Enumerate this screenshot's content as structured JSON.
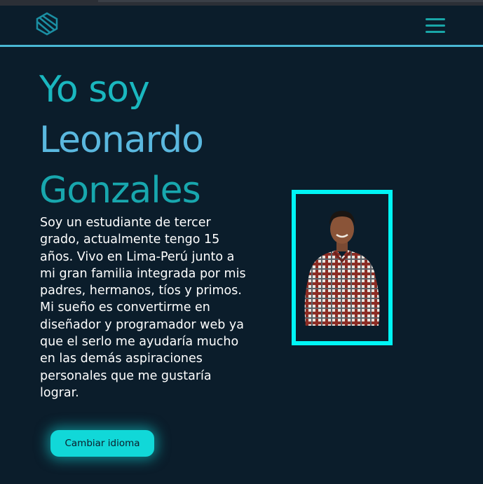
{
  "browser": {
    "chrome": "top-strip"
  },
  "navbar": {
    "logo_icon": "cube-logo-icon",
    "menu_icon": "hamburger-menu-icon",
    "accent_color": "#4ab8d4"
  },
  "hero": {
    "title_line1": "Yo soy",
    "title_line2": "Leonardo",
    "title_line3": "Gonzales",
    "bio": "Soy un estudiante de tercer grado, actualmente tengo 15 años. Vivo en Lima-Perú junto a mi gran familia integrada por mis padres, hermanos, tíos y primos. Mi sueño es convertirme en diseñador y programador web ya que el serlo me ayudaría mucho en las demás aspiraciones personales que me gustaría lograr.",
    "button_label": "Cambiar idioma",
    "title_colors": [
      "#1ab7bf",
      "#5ab8df",
      "#18a7ae"
    ],
    "button_color": "#11d8d8"
  },
  "profile": {
    "photo_icon": "profile-photo",
    "frame_color": "#00f5f5"
  }
}
